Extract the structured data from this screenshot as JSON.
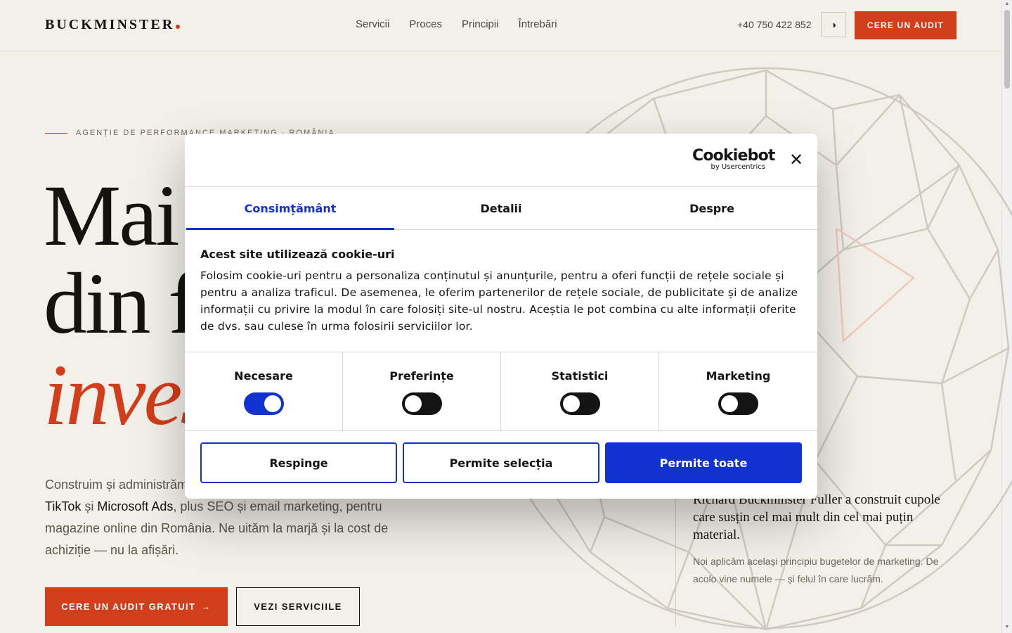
{
  "header": {
    "logo": "BUCKMINSTER",
    "nav": [
      "Servicii",
      "Proces",
      "Principii",
      "Întrebări"
    ],
    "phone": "+40 750 422 852",
    "theme_icon": "◑",
    "cta": "CERE UN AUDIT"
  },
  "hero": {
    "eyebrow": "AGENȚIE DE PERFORMANCE MARKETING · ROMÂNIA",
    "line1": "Mai",
    "line2": "din f",
    "line3": "inves",
    "desc_start": "Construim și administrăm",
    "desc_link1": "TikTok",
    "desc_and": " și ",
    "desc_link2": "Microsoft Ads",
    "desc_rest": ", plus SEO și email marketing, pentru magazine online din România. Ne uităm la marjă și la cost de achiziție — nu la afișări.",
    "cta_primary": "CERE UN AUDIT GRATUIT",
    "cta_arrow": "→",
    "cta_secondary": "VEZI SERVICIILE"
  },
  "quote": {
    "title": "Richard Buckminster Fuller a construit cupole care susțin cel mai mult din cel mai puțin material.",
    "body": "Noi aplicăm același principiu bugetelor de marketing. De acolo vine numele — și felul în care lucrăm."
  },
  "dialog": {
    "brand": "Cookiebot",
    "brand_sub": "by Usercentrics",
    "close": "✕",
    "tabs": [
      "Consimțământ",
      "Detalii",
      "Despre"
    ],
    "active_tab": 0,
    "heading": "Acest site utilizează cookie-uri",
    "body": "Folosim cookie-uri pentru a personaliza conținutul și anunțurile, pentru a oferi funcții de rețele sociale și pentru a analiza traficul. De asemenea, le oferim partenerilor de rețele sociale, de publicitate și de analize informații cu privire la modul în care folosiți site-ul nostru. Aceștia le pot combina cu alte informații oferite de dvs. sau culese în urma folosirii serviciilor lor.",
    "toggles": [
      {
        "label": "Necesare",
        "on": true
      },
      {
        "label": "Preferințe",
        "on": false
      },
      {
        "label": "Statistici",
        "on": false
      },
      {
        "label": "Marketing",
        "on": false
      }
    ],
    "buttons": {
      "reject": "Respinge",
      "allow_selection": "Permite selecția",
      "allow_all": "Permite toate"
    }
  },
  "colors": {
    "accent": "#d23d1b",
    "dialog_primary": "#1032cf",
    "background": "#f3f0ea"
  },
  "icons": [
    "contrast-icon",
    "close-icon",
    "arrow-right-icon",
    "geodesic-sphere"
  ]
}
